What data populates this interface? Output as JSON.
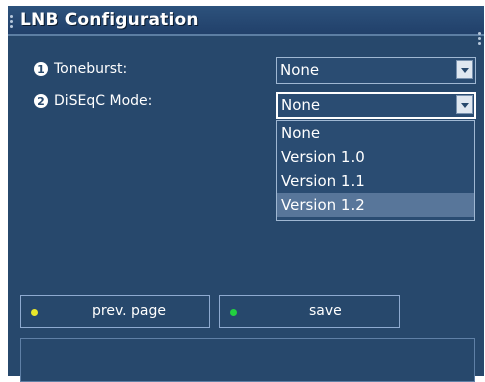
{
  "window": {
    "title": "LNB Configuration"
  },
  "fields": [
    {
      "number": "1",
      "label": "Toneburst:",
      "value": "None"
    },
    {
      "number": "2",
      "label": "DiSEqC Mode:",
      "value": "None"
    }
  ],
  "dropdown": {
    "options": [
      "None",
      "Version 1.0",
      "Version 1.1",
      "Version 1.2"
    ],
    "highlighted": "Version 1.2"
  },
  "buttons": {
    "prev_page": {
      "label": "prev. page",
      "color": "#e8e62a"
    },
    "save": {
      "label": "save",
      "color": "#22d040"
    }
  },
  "colors": {
    "background": "#27486c",
    "highlight": "#58769a",
    "border": "#9fb7d2"
  },
  "status": ""
}
